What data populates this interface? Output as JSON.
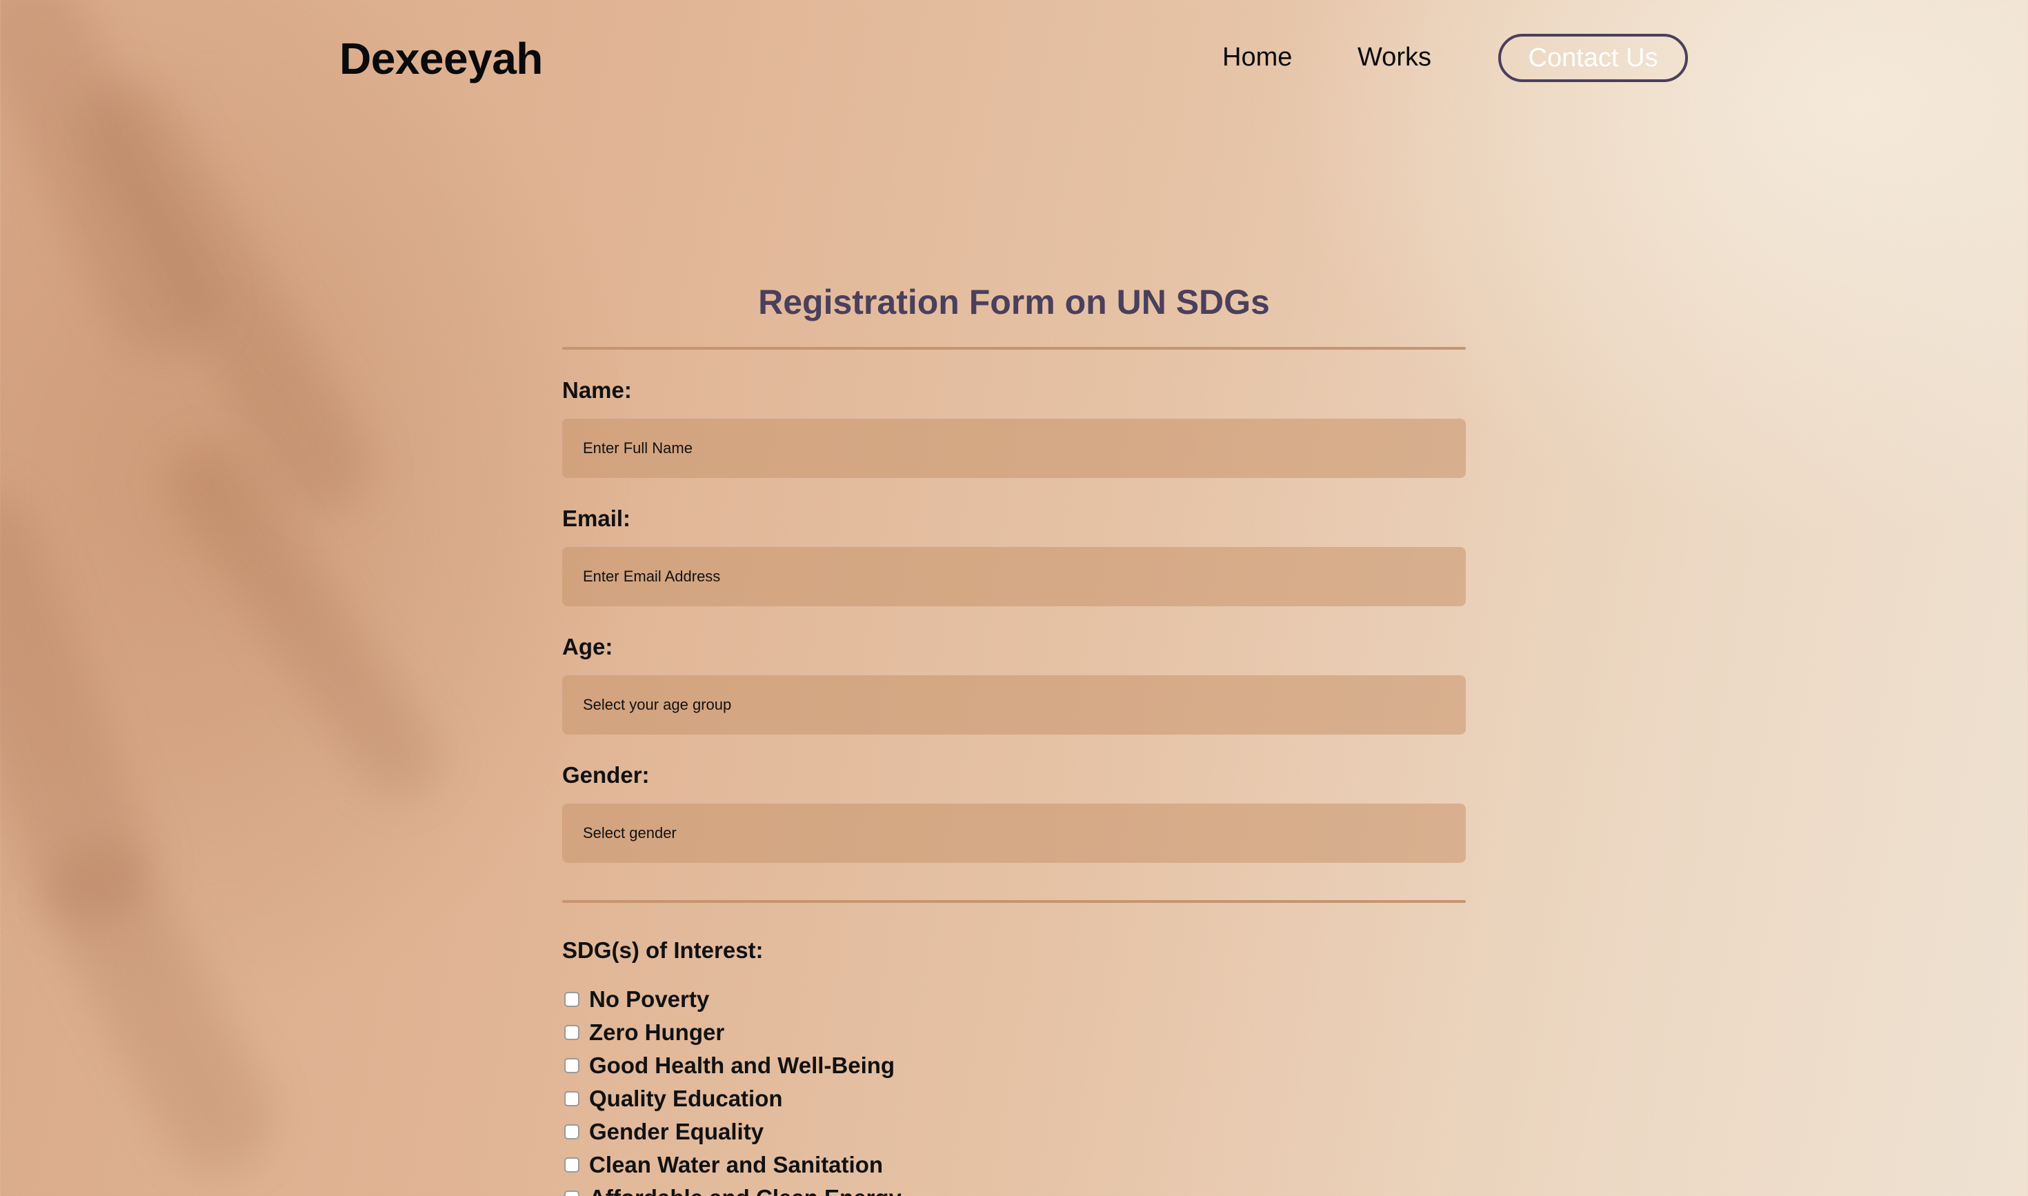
{
  "nav": {
    "logo": "Dexeeyah",
    "links": [
      {
        "label": "Home"
      },
      {
        "label": "Works"
      }
    ],
    "contact_label": "Contact Us"
  },
  "form": {
    "title": "Registration Form on UN SDGs",
    "fields": [
      {
        "label": "Name:",
        "placeholder": "Enter Full Name",
        "type": "text"
      },
      {
        "label": "Email:",
        "placeholder": "Enter Email Address",
        "type": "text"
      },
      {
        "label": "Age:",
        "placeholder": "Select your age group",
        "type": "select"
      },
      {
        "label": "Gender:",
        "placeholder": "Select gender",
        "type": "select"
      }
    ],
    "sdg_label": "SDG(s) of Interest:",
    "sdgs": [
      "No Poverty",
      "Zero Hunger",
      "Good Health and Well-Being",
      "Quality Education",
      "Gender Equality",
      "Clean Water and Sanitation",
      "Affordable and Clean Energy"
    ]
  },
  "colors": {
    "accent": "#4a3f5c",
    "divider": "#c79470",
    "input_bg": "#d4a882"
  }
}
